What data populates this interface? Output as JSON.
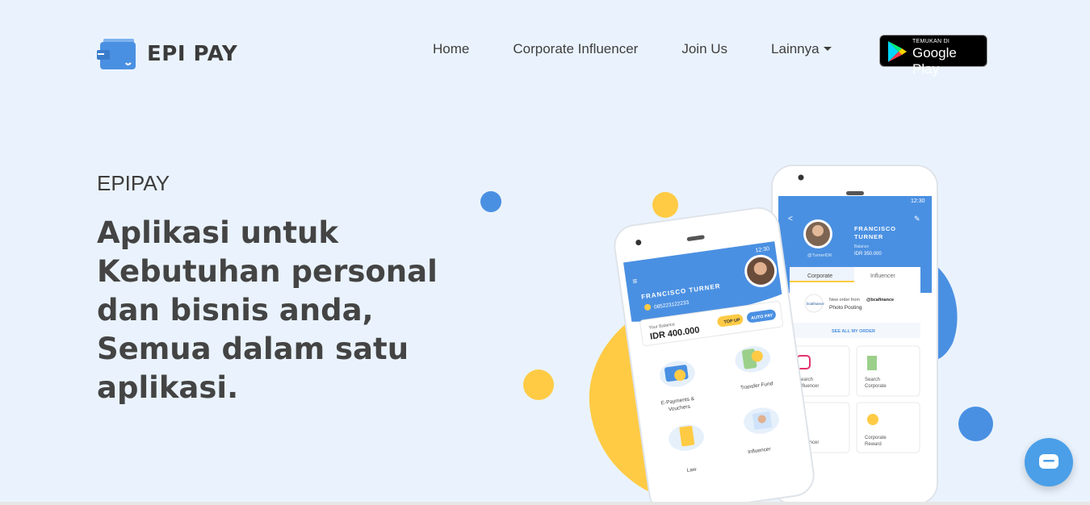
{
  "brand": {
    "name": "EPI PAY",
    "icon": "wallet-icon"
  },
  "nav": {
    "items": [
      {
        "label": "Home"
      },
      {
        "label": "Corporate Influencer"
      },
      {
        "label": "Join Us"
      },
      {
        "label": "Lainnya"
      }
    ],
    "google_play": {
      "small": "TEMUKAN DI",
      "big": "Google Play"
    }
  },
  "hero": {
    "eyebrow": "EPIPAY",
    "title": "Aplikasi untuk Kebutuhan personal dan bisnis anda, Semua dalam satu aplikasi."
  },
  "phone_front": {
    "time": "12:30",
    "user": "FRANCISCO TURNER",
    "phone": "085223122233",
    "balance_label": "Your Balance",
    "balance": "IDR 400.000",
    "topup": "TOP UP",
    "autopay": "AUTO PAY",
    "menu": [
      "E-Payments & Vouchers",
      "Transfer Fund",
      "Law",
      "Influencer"
    ]
  },
  "phone_back": {
    "time": "12:30",
    "user": "FRANCISCO TURNER",
    "balance_label": "Balance",
    "balance": "IDR 350.000",
    "handle": "@TurnerIDK",
    "tabs": [
      "Corporate",
      "Influencer"
    ],
    "order_from": "New order from",
    "order_handle": "@bcafinance",
    "order_type": "Photo Posting",
    "see_all": "SEE ALL MY ORDER",
    "tiles": [
      "Search Influencer",
      "Search Corporate",
      "Influencer",
      "Corporate Reward"
    ]
  },
  "colors": {
    "bg": "#eaf3fd",
    "blue": "#4a90e2",
    "yellow": "#ffcb45",
    "text": "#444444"
  }
}
